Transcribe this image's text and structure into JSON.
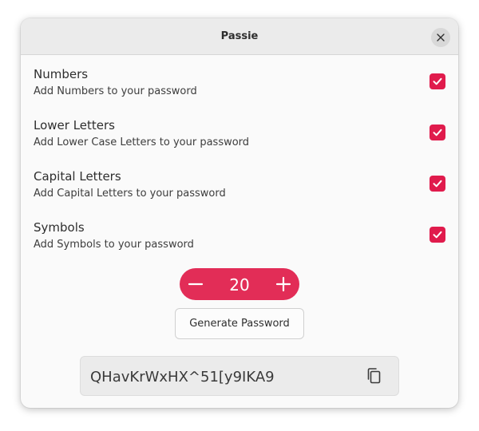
{
  "window": {
    "title": "Passie"
  },
  "icons": {
    "close": "close-icon",
    "check": "checkmark-icon",
    "minus": "minus-icon",
    "plus": "plus-icon",
    "copy": "copy-icon"
  },
  "colors": {
    "accent": "#e01b4c",
    "spin_background": "#e22d57"
  },
  "options": [
    {
      "title": "Numbers",
      "subtitle": "Add Numbers to your password",
      "checked": true
    },
    {
      "title": "Lower Letters",
      "subtitle": "Add Lower Case Letters to your password",
      "checked": true
    },
    {
      "title": "Capital Letters",
      "subtitle": "Add Capital Letters to your password",
      "checked": true
    },
    {
      "title": "Symbols",
      "subtitle": "Add Symbols to your password",
      "checked": true
    }
  ],
  "length": {
    "value": "20"
  },
  "generate_button": {
    "label": "Generate Password"
  },
  "password": {
    "value": "QHavKrWxHX^51[y9IKA9"
  }
}
